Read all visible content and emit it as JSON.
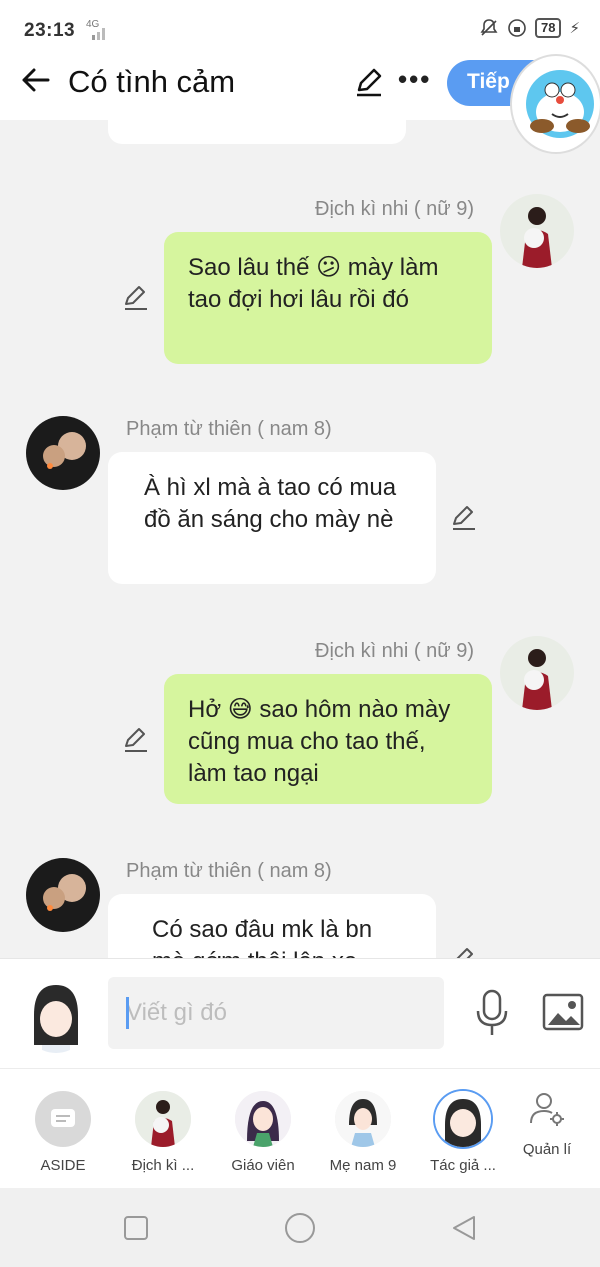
{
  "status_bar": {
    "time": "23:13",
    "network": "4G",
    "battery": "78"
  },
  "header": {
    "title": "Có tình cảm",
    "next_label": "Tiếp"
  },
  "messages": [
    {
      "side": "left",
      "text": ""
    },
    {
      "side": "right",
      "name": "Địch kì nhi ( nữ 9)",
      "text": "Sao lâu thế 😕 mày làm tao đợi hơi lâu rồi đó"
    },
    {
      "side": "left",
      "name": "Phạm từ thiên ( nam 8)",
      "text": "À hì xl mà à tao có mua đồ ăn sáng cho mày nè"
    },
    {
      "side": "right",
      "name": "Địch kì nhi ( nữ 9)",
      "text": "Hở 😅  sao hôm nào mày cũng mua cho tao thế, làm tao ngại"
    },
    {
      "side": "left",
      "name": "Phạm từ thiên ( nam 8)",
      "text": "Có sao đâu mk là bn mà gớm thôi lên xe"
    }
  ],
  "composer": {
    "placeholder": "Viết gì đó"
  },
  "characters": [
    {
      "label": "ASIDE"
    },
    {
      "label": "Địch kì ..."
    },
    {
      "label": "Giáo viên"
    },
    {
      "label": "Mẹ nam 9"
    },
    {
      "label": "Tác giả ..."
    },
    {
      "label": "Quản lí"
    }
  ],
  "colors": {
    "accent": "#5a9cf2",
    "my_bubble": "#d6f59e",
    "their_bubble": "#ffffff"
  }
}
